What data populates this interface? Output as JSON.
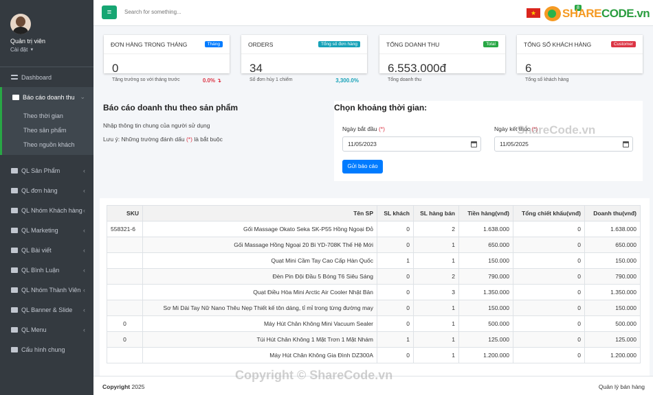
{
  "user": {
    "name": "Quản trị viên",
    "sub": "Cài đặt"
  },
  "sidebar": {
    "dashboard": "Dashboard",
    "report": "Báo cáo doanh thu",
    "report_sub": [
      "Theo thời gian",
      "Theo sản phẩm",
      "Theo nguồn khách"
    ],
    "items": [
      "QL Sản Phẩm",
      "QL đơn hàng",
      "QL Nhóm Khách hàng",
      "QL Marketing",
      "QL Bài viết",
      "QL Bình Luận",
      "QL Nhóm Thành Viên",
      "QL Banner & Slide",
      "QL Menu",
      "Cấu hình chung"
    ]
  },
  "topbar": {
    "search_placeholder": "Search for something...",
    "logo_a": "SHARE",
    "logo_b": "CODE.vn",
    "badge": "8"
  },
  "cards": [
    {
      "title": "ĐƠN HÀNG TRONG THÁNG",
      "label": "Tháng",
      "label_color": "#007bff",
      "value": "0",
      "desc": "Tăng trưởng so với tháng trước",
      "pct": "0.0% ↴",
      "pct_color": "#dc3545"
    },
    {
      "title": "ORDERS",
      "label": "Tổng số đơn hàng",
      "label_color": "#17a2b8",
      "value": "34",
      "desc": "Số đơn hủy 1 chiếm",
      "pct": "3,300.0%",
      "pct_color": "#17a2b8"
    },
    {
      "title": "TỔNG DOANH THU",
      "label": "Total",
      "label_color": "#28a745",
      "value": "6.553.000đ",
      "desc": "Tổng doanh thu",
      "pct": "",
      "pct_color": "#333"
    },
    {
      "title": "TỔNG SỐ KHÁCH HÀNG",
      "label": "Customer",
      "label_color": "#dc3545",
      "value": "6",
      "desc": "Tổng số khách hàng",
      "pct": "",
      "pct_color": "#333"
    }
  ],
  "report": {
    "title": "Báo cáo doanh thu theo sản phẩm",
    "line1": "Nhập thông tin chung của người sử dụng",
    "line2a": "Lưu ý: Những trường đánh dấu",
    "req": "(*)",
    "line2b": "là bắt buộc"
  },
  "dateform": {
    "title": "Chọn khoảng thời gian:",
    "start_label": "Ngày bắt đầu",
    "end_label": "Ngày kết thúc",
    "req": "(*)",
    "start_value": "11/05/2023",
    "end_value": "11/05/2025",
    "submit": "Gửi báo cáo"
  },
  "table": {
    "headers": [
      "SKU",
      "Tên SP",
      "SL khách",
      "SL hàng bán",
      "Tiền hàng(vnđ)",
      "Tổng chiết khấu(vnđ)",
      "Doanh thu(vnđ)"
    ],
    "rows": [
      [
        "558321-6",
        "Gối Massage Okato Seka SK-P55 Hồng Ngoại Đỏ",
        "0",
        "2",
        "1.638.000",
        "0",
        "1.638.000"
      ],
      [
        "",
        "Gối Massage Hồng Ngoại 20 Bi YD-708K Thế Hệ Mới",
        "0",
        "1",
        "650.000",
        "0",
        "650.000"
      ],
      [
        "",
        "Quạt Mini Cầm Tay Cao Cấp Hàn Quốc",
        "1",
        "1",
        "150.000",
        "0",
        "150.000"
      ],
      [
        "",
        "Đèn Pin Đội Đầu 5 Bóng T6 Siêu Sáng",
        "0",
        "2",
        "790.000",
        "0",
        "790.000"
      ],
      [
        "",
        "Quạt Điều Hòa Mini Arctic Air Cooler Nhật Bản",
        "0",
        "3",
        "1.350.000",
        "0",
        "1.350.000"
      ],
      [
        "",
        "Sơ Mi Dài Tay Nữ Nano Thêu Nẹp Thiết kế tôn dáng, tỉ mỉ trong từng đường may",
        "0",
        "1",
        "150.000",
        "0",
        "150.000"
      ],
      [
        "0",
        "Máy Hút Chân Không Mini Vacuum Sealer",
        "0",
        "1",
        "500.000",
        "0",
        "500.000"
      ],
      [
        "0",
        "Túi Hút Chân Không 1 Mặt Trơn 1 Mặt Nhám",
        "1",
        "1",
        "125.000",
        "0",
        "125.000"
      ],
      [
        "",
        "Máy Hút Chân Không Gia Đình DZ300A",
        "0",
        "1",
        "1.200.000",
        "0",
        "1.200.000"
      ]
    ]
  },
  "footer": {
    "copyright": "Copyright",
    "year": "2025",
    "right": "Quản lý bán hàng"
  },
  "watermarks": [
    "ShareCode.vn",
    "Copyright © ShareCode.vn"
  ]
}
